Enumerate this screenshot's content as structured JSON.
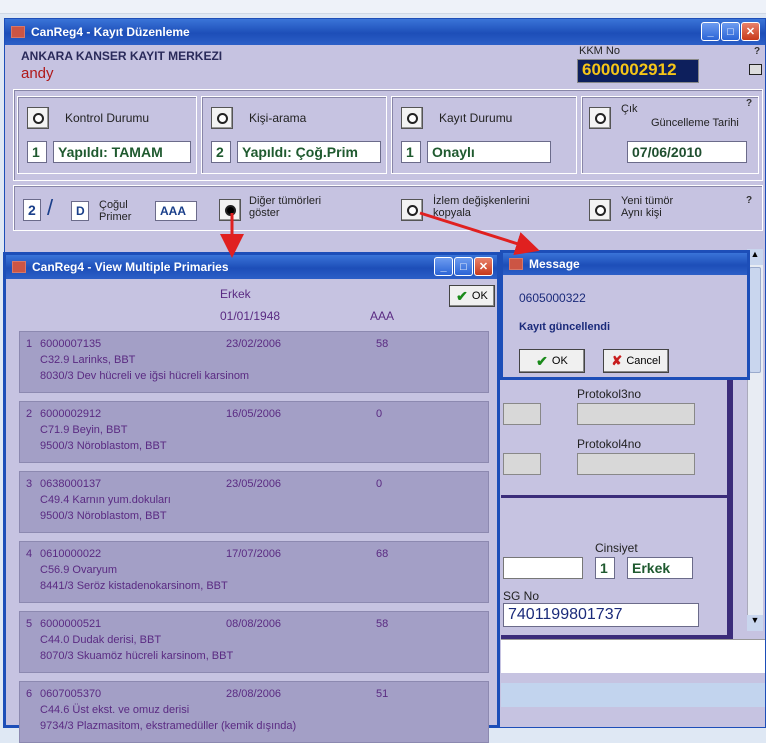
{
  "main_window": {
    "title": "CanReg4 - Kayıt Düzenleme",
    "org": "ANKARA KANSER KAYIT MERKEZI",
    "user": "andy",
    "kkm_label": "KKM No",
    "kkm_value": "6000002912",
    "help": "?",
    "kontrol": {
      "label": "Kontrol Durumu",
      "num": "1",
      "value": "Yapıldı: TAMAM"
    },
    "kisi": {
      "label": "Kişi-arama",
      "num": "2",
      "value": "Yapıldı: Çoğ.Prim"
    },
    "kayit": {
      "label": "Kayıt Durumu",
      "num": "1",
      "value": "Onaylı"
    },
    "cik": {
      "label": "Çık",
      "label2": "Güncelleme Tarihi",
      "value": "07/06/2010"
    },
    "cogul": {
      "num": "2",
      "slash": "/",
      "letter": "D",
      "label1": "Çoğul",
      "label2": "Primer",
      "code": "AAA"
    },
    "diger": {
      "label1": "Diğer tümörleri",
      "label2": "göster"
    },
    "izlem": {
      "label1": "İzlem değişkenlerini",
      "label2": "kopyala"
    },
    "yeni": {
      "label1": "Yeni tümör",
      "label2": "Aynı kişi"
    },
    "protokol3": "Protokol3no",
    "protokol4": "Protokol4no",
    "cinsiyet_label": "Cinsiyet",
    "cinsiyet_num": "1",
    "cinsiyet_value": "Erkek",
    "sgno_label": "SG No",
    "sgno_value": "7401199801737"
  },
  "mp_window": {
    "title": "CanReg4 - View Multiple Primaries",
    "sex": "Erkek",
    "dob": "01/01/1948",
    "code": "AAA",
    "ok": "OK",
    "rows": [
      {
        "idx": "1",
        "id": "6000007135",
        "date": "23/02/2006",
        "score": "58",
        "topo": "C32.9  Larinks, BBT",
        "morph": "8030/3  Dev hücreli ve iğsi hücreli karsinom"
      },
      {
        "idx": "2",
        "id": "6000002912",
        "date": "16/05/2006",
        "score": "0",
        "topo": "C71.9  Beyin, BBT",
        "morph": "9500/3  Nöroblastom, BBT"
      },
      {
        "idx": "3",
        "id": "0638000137",
        "date": "23/05/2006",
        "score": "0",
        "topo": "C49.4  Karnın yum.dokuları",
        "morph": "9500/3  Nöroblastom, BBT"
      },
      {
        "idx": "4",
        "id": "0610000022",
        "date": "17/07/2006",
        "score": "68",
        "topo": "C56.9  Ovaryum",
        "morph": "8441/3  Seröz kistadenokarsinom, BBT"
      },
      {
        "idx": "5",
        "id": "6000000521",
        "date": "08/08/2006",
        "score": "58",
        "topo": "C44.0  Dudak derisi, BBT",
        "morph": "8070/3  Skuamöz hücreli karsinom, BBT"
      },
      {
        "idx": "6",
        "id": "0607005370",
        "date": "28/08/2006",
        "score": "51",
        "topo": "C44.6  Üst ekst. ve omuz derisi",
        "morph": "9734/3  Plazmasitom, ekstramedüller (kemik dışında)"
      }
    ]
  },
  "msg_window": {
    "title": "Message",
    "id": "0605000322",
    "text": "Kayıt güncellendi",
    "ok": "OK",
    "cancel": "Cancel"
  },
  "colors": {
    "title_blue": "#1d4eb8",
    "lavender": "#c6c3e1",
    "row_purple": "#a39fc6",
    "arrow_red": "#e02020"
  }
}
